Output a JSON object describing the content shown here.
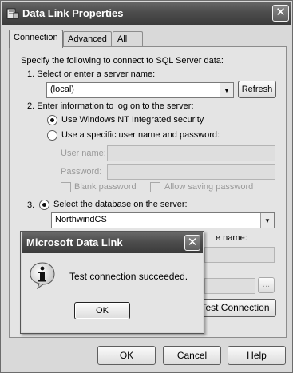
{
  "window": {
    "title": "Data Link Properties",
    "close_glyph": "✕",
    "title_icon": "data-link-icon"
  },
  "tabs": [
    {
      "label": "Connection",
      "active": true
    },
    {
      "label": "Advanced",
      "active": false
    },
    {
      "label": "All",
      "active": false
    }
  ],
  "connection": {
    "intro": "Specify the following to connect to SQL Server data:",
    "step1_label": "1. Select or enter a server name:",
    "server_value": "(local)",
    "refresh_label": "Refresh",
    "step2_label": "2. Enter information to log on to the server:",
    "windows_auth_label": "Use Windows NT Integrated security",
    "specific_auth_label": "Use a specific user name and password:",
    "username_label": "User name:",
    "password_label": "Password:",
    "blank_password_label": "Blank password",
    "allow_saving_label": "Allow saving password",
    "step3_num": "3.",
    "select_db_label": "Select the database on the server:",
    "database_value": "NorthwindCS",
    "attach_label_fragment": "e name:",
    "browse_label": "...",
    "test_connection_label": "Test Connection"
  },
  "footer": {
    "ok": "OK",
    "cancel": "Cancel",
    "help": "Help"
  },
  "dialog": {
    "title": "Microsoft Data Link",
    "close_glyph": "✕",
    "message": "Test connection succeeded.",
    "ok": "OK",
    "icon": "information-icon"
  }
}
